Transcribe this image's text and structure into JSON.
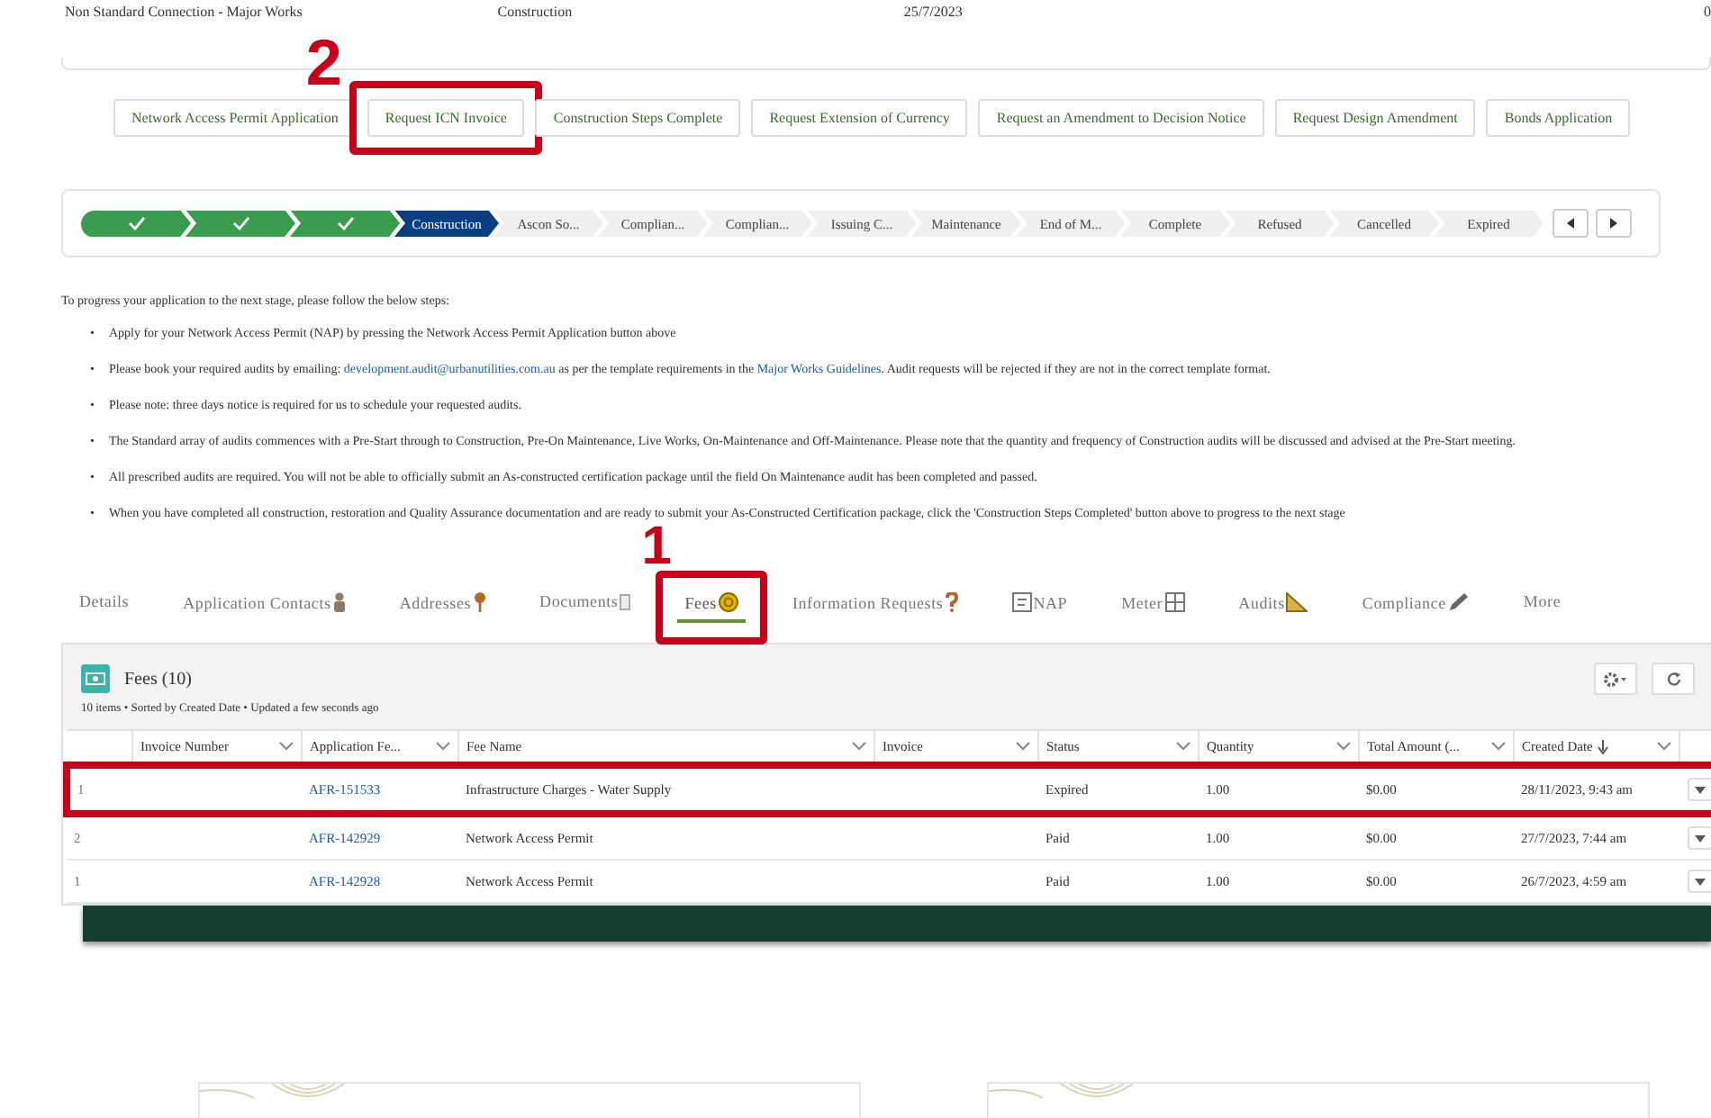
{
  "record_row": [
    "Non Standard Connection - Major Works",
    "Construction",
    "25/7/2023",
    "0"
  ],
  "actions": [
    {
      "label": "Network Access Permit Application",
      "highlighted": false
    },
    {
      "label": "Request ICN Invoice",
      "highlighted": true,
      "callout": "2"
    },
    {
      "label": "Construction Steps Complete",
      "highlighted": false
    },
    {
      "label": "Request Extension of Currency",
      "highlighted": false
    },
    {
      "label": "Request an Amendment to Decision Notice",
      "highlighted": false
    },
    {
      "label": "Request Design Amendment",
      "highlighted": false
    },
    {
      "label": "Bonds Application",
      "highlighted": false
    }
  ],
  "path": [
    {
      "kind": "done"
    },
    {
      "kind": "done"
    },
    {
      "kind": "done"
    },
    {
      "kind": "current",
      "label": "Construction"
    },
    {
      "kind": "pending",
      "label": "Ascon So..."
    },
    {
      "kind": "pending",
      "label": "Complian..."
    },
    {
      "kind": "pending",
      "label": "Complian..."
    },
    {
      "kind": "pending",
      "label": "Issuing C..."
    },
    {
      "kind": "pending",
      "label": "Maintenance"
    },
    {
      "kind": "pending",
      "label": "End of M..."
    },
    {
      "kind": "pending",
      "label": "Complete"
    },
    {
      "kind": "pending",
      "label": "Refused"
    },
    {
      "kind": "pending",
      "label": "Cancelled"
    },
    {
      "kind": "pending",
      "label": "Expired"
    }
  ],
  "instructions": {
    "intro": "To progress your application to the next stage, please follow the below steps:",
    "steps": [
      {
        "bullet": "•",
        "text": "Apply for your Network Access Permit (NAP) by pressing the Network Access Permit Application button above"
      },
      {
        "bullet": "•",
        "before": "Please book your required audits by emailing: ",
        "link1": "development.audit@urbanutilities.com.au",
        "middle": " as per the template requirements in the ",
        "link2": "Major Works Guidelines",
        "after": ". Audit requests will be rejected if they are not in the correct template format."
      },
      {
        "bullet": "•",
        "text": "Please note: three days notice is required for us to schedule your requested audits."
      },
      {
        "bullet": "•",
        "text": "The Standard array of audits commences with a Pre-Start through to Construction, Pre-On Maintenance, Live Works, On-Maintenance and Off-Maintenance. Please note that the quantity and frequency of Construction audits will be discussed and advised at the Pre-Start meeting."
      },
      {
        "bullet": "•",
        "text": "All prescribed audits are required. You will not be able to officially submit an As-constructed certification package until the field On Maintenance audit has been completed and passed."
      },
      {
        "bullet": "•",
        "text": "When you have completed all construction, restoration and Quality Assurance documentation and are ready to submit your As-Constructed Certification package, click the 'Construction Steps Completed' button above to progress to the next stage"
      }
    ]
  },
  "tabs": [
    {
      "label": "Details",
      "selected": false,
      "highlighted": false
    },
    {
      "label": "Application Contacts",
      "selected": false,
      "highlighted": false
    },
    {
      "label": "Addresses",
      "selected": false,
      "highlighted": false
    },
    {
      "label": "Documents",
      "selected": false,
      "highlighted": false
    },
    {
      "label": "Fees",
      "selected": true,
      "highlighted": true,
      "callout": "1"
    },
    {
      "label": "Information Requests",
      "selected": false,
      "highlighted": false
    },
    {
      "label": "NAP",
      "selected": false,
      "highlighted": false
    },
    {
      "label": "Meter",
      "selected": false,
      "highlighted": false
    },
    {
      "label": "Audits",
      "selected": false,
      "highlighted": false
    },
    {
      "label": "Compliance",
      "selected": false,
      "highlighted": false
    },
    {
      "label": "More",
      "selected": false,
      "highlighted": false
    }
  ],
  "fees": {
    "title": "Fees (10)",
    "subtitle": "10 items • Sorted by Created Date • Updated a few seconds ago",
    "columns": [
      "Invoice Number",
      "Application Fe...",
      "Fee Name",
      "Invoice",
      "Status",
      "Quantity",
      "Total Amount (...",
      "Created Date"
    ],
    "rows": [
      {
        "number": "1",
        "application_fee": "AFR-151533",
        "fee_name": "Infrastructure Charges - Water Supply",
        "status": "Expired",
        "quantity": "1.00",
        "total": "$0.00",
        "created": "28/11/2023, 9:43 am",
        "highlighted": true
      },
      {
        "number": "2",
        "application_fee": "AFR-142929",
        "fee_name": "Network Access Permit",
        "status": "Paid",
        "quantity": "1.00",
        "total": "$0.00",
        "created": "27/7/2023, 7:44 am",
        "highlighted": false
      },
      {
        "number": "1",
        "application_fee": "AFR-142928",
        "fee_name": "Network Access Permit",
        "status": "Paid",
        "quantity": "1.00",
        "total": "$0.00",
        "created": "26/7/2023, 4:59 am",
        "highlighted": false
      }
    ]
  }
}
